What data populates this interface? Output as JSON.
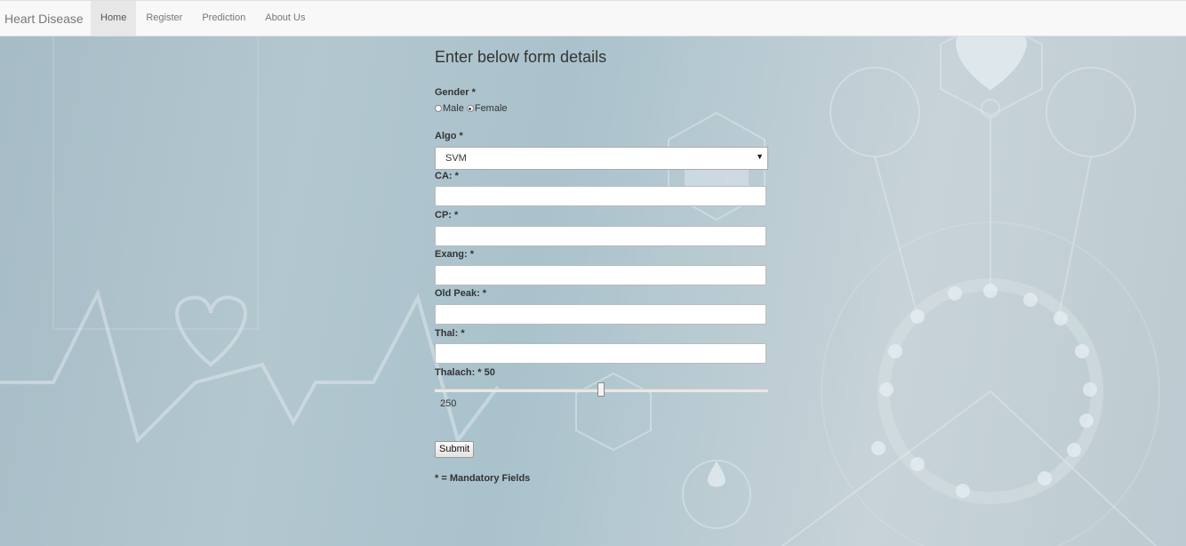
{
  "navbar": {
    "brand": "Heart Disease",
    "items": [
      {
        "label": "Home",
        "active": true
      },
      {
        "label": "Register"
      },
      {
        "label": "Prediction"
      },
      {
        "label": "About Us"
      }
    ]
  },
  "form": {
    "heading": "Enter below form details",
    "gender": {
      "label": "Gender *",
      "options": [
        "Male",
        "Female"
      ],
      "selected": "Female"
    },
    "algo": {
      "label": "Algo *",
      "selected": "SVM"
    },
    "ca": {
      "label": "CA: *",
      "value": ""
    },
    "cp": {
      "label": "CP: *",
      "value": ""
    },
    "exang": {
      "label": "Exang: *",
      "value": ""
    },
    "oldpeak": {
      "label": "Old Peak: *",
      "value": ""
    },
    "thal": {
      "label": "Thal: *",
      "value": ""
    },
    "thalach": {
      "label": "Thalach: * 50",
      "value_display": "250"
    },
    "submit_label": "Submit",
    "mandatory_note": "* = Mandatory Fields"
  }
}
